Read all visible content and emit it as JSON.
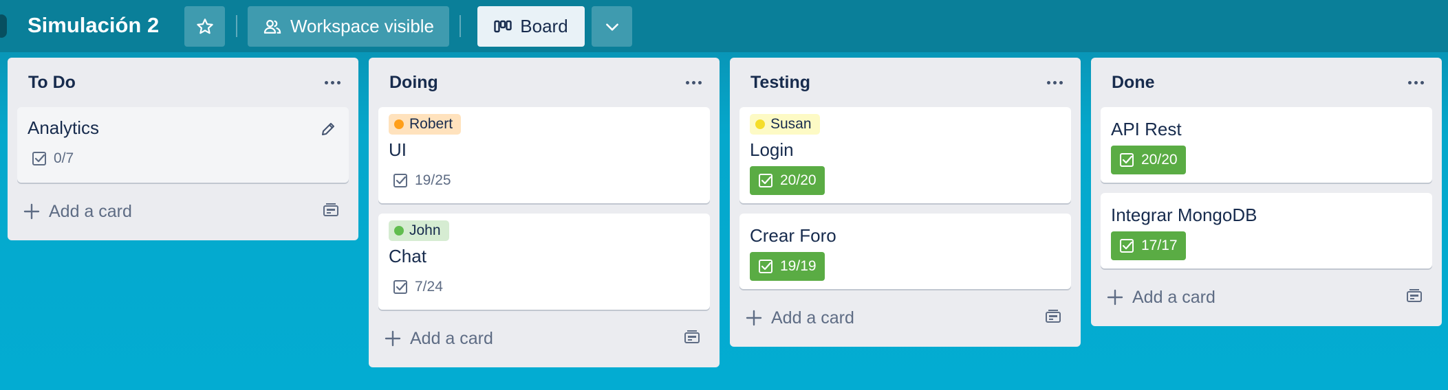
{
  "header": {
    "title": "Simulación 2",
    "star_icon": "star-icon",
    "visibility_label": "Workspace visible",
    "visibility_icon": "people-icon",
    "view_label": "Board",
    "view_icon": "board-icon",
    "switch_icon": "chevron-down-icon"
  },
  "colors": {
    "header_bg": "#0a7f99",
    "board_bg": "#03acd2",
    "list_bg": "#ebecf0",
    "checklist_done": "#5aac44",
    "label_orange": "#ffe2bd",
    "label_orange_dot": "#ff9f1a",
    "label_yellow": "#fdfac5",
    "label_yellow_dot": "#f5dd29",
    "label_green": "#d6ecd2",
    "label_green_dot": "#61bd4f"
  },
  "lists": [
    {
      "title": "To Do",
      "cards": [
        {
          "title": "Analytics",
          "checklist": "0/7",
          "complete": false,
          "editing": true
        }
      ],
      "add_label": "Add a card"
    },
    {
      "title": "Doing",
      "cards": [
        {
          "label": "Robert",
          "label_color": "orange",
          "title": "UI",
          "checklist": "19/25",
          "complete": false
        },
        {
          "label": "John",
          "label_color": "green",
          "title": "Chat",
          "checklist": "7/24",
          "complete": false
        }
      ],
      "add_label": "Add a card"
    },
    {
      "title": "Testing",
      "cards": [
        {
          "label": "Susan",
          "label_color": "yellow",
          "title": "Login",
          "checklist": "20/20",
          "complete": true
        },
        {
          "title": "Crear Foro",
          "checklist": "19/19",
          "complete": true
        }
      ],
      "add_label": "Add a card"
    },
    {
      "title": "Done",
      "cards": [
        {
          "title": "API Rest",
          "checklist": "20/20",
          "complete": true
        },
        {
          "title": "Integrar MongoDB",
          "checklist": "17/17",
          "complete": true
        }
      ],
      "add_label": "Add a card"
    }
  ]
}
